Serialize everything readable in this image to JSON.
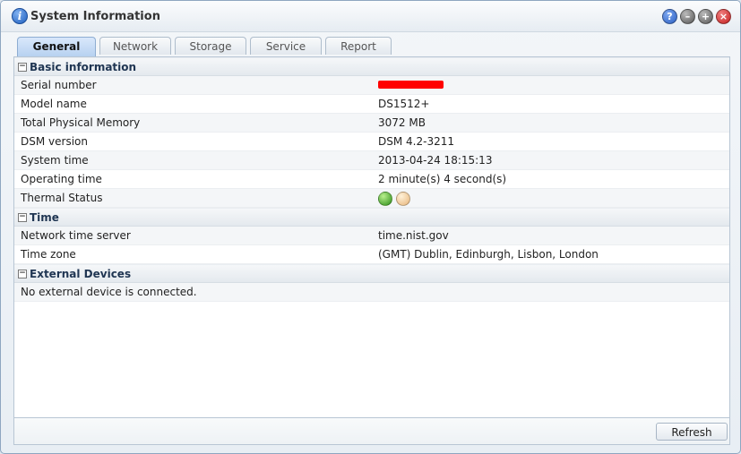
{
  "window": {
    "title": "System Information"
  },
  "tabs": [
    {
      "label": "General",
      "active": true
    },
    {
      "label": "Network",
      "active": false
    },
    {
      "label": "Storage",
      "active": false
    },
    {
      "label": "Service",
      "active": false
    },
    {
      "label": "Report",
      "active": false
    }
  ],
  "sections": {
    "basic": {
      "title": "Basic information",
      "rows": {
        "serial": {
          "label": "Serial number",
          "value": ""
        },
        "model": {
          "label": "Model name",
          "value": "DS1512+"
        },
        "memory": {
          "label": "Total Physical Memory",
          "value": "3072 MB"
        },
        "dsm": {
          "label": "DSM version",
          "value": "DSM 4.2-3211"
        },
        "systime": {
          "label": "System time",
          "value": "2013-04-24 18:15:13"
        },
        "optime": {
          "label": "Operating time",
          "value": "2 minute(s) 4 second(s)"
        },
        "thermal": {
          "label": "Thermal Status",
          "value": ""
        }
      }
    },
    "time": {
      "title": "Time",
      "rows": {
        "ntp": {
          "label": "Network time server",
          "value": "time.nist.gov"
        },
        "tz": {
          "label": "Time zone",
          "value": "(GMT) Dublin, Edinburgh, Lisbon, London"
        }
      }
    },
    "external": {
      "title": "External Devices",
      "message": "No external device is connected."
    }
  },
  "footer": {
    "refresh_label": "Refresh"
  },
  "icons": {
    "app": "info-icon",
    "help": "help-icon",
    "minimize": "minimize-icon",
    "maximize": "maximize-icon",
    "close": "close-icon",
    "collapse": "collapse-icon"
  },
  "colors": {
    "redaction": "#ff0000",
    "thermal_normal": "#2c8d18",
    "thermal_warning": "#e7b57a"
  }
}
